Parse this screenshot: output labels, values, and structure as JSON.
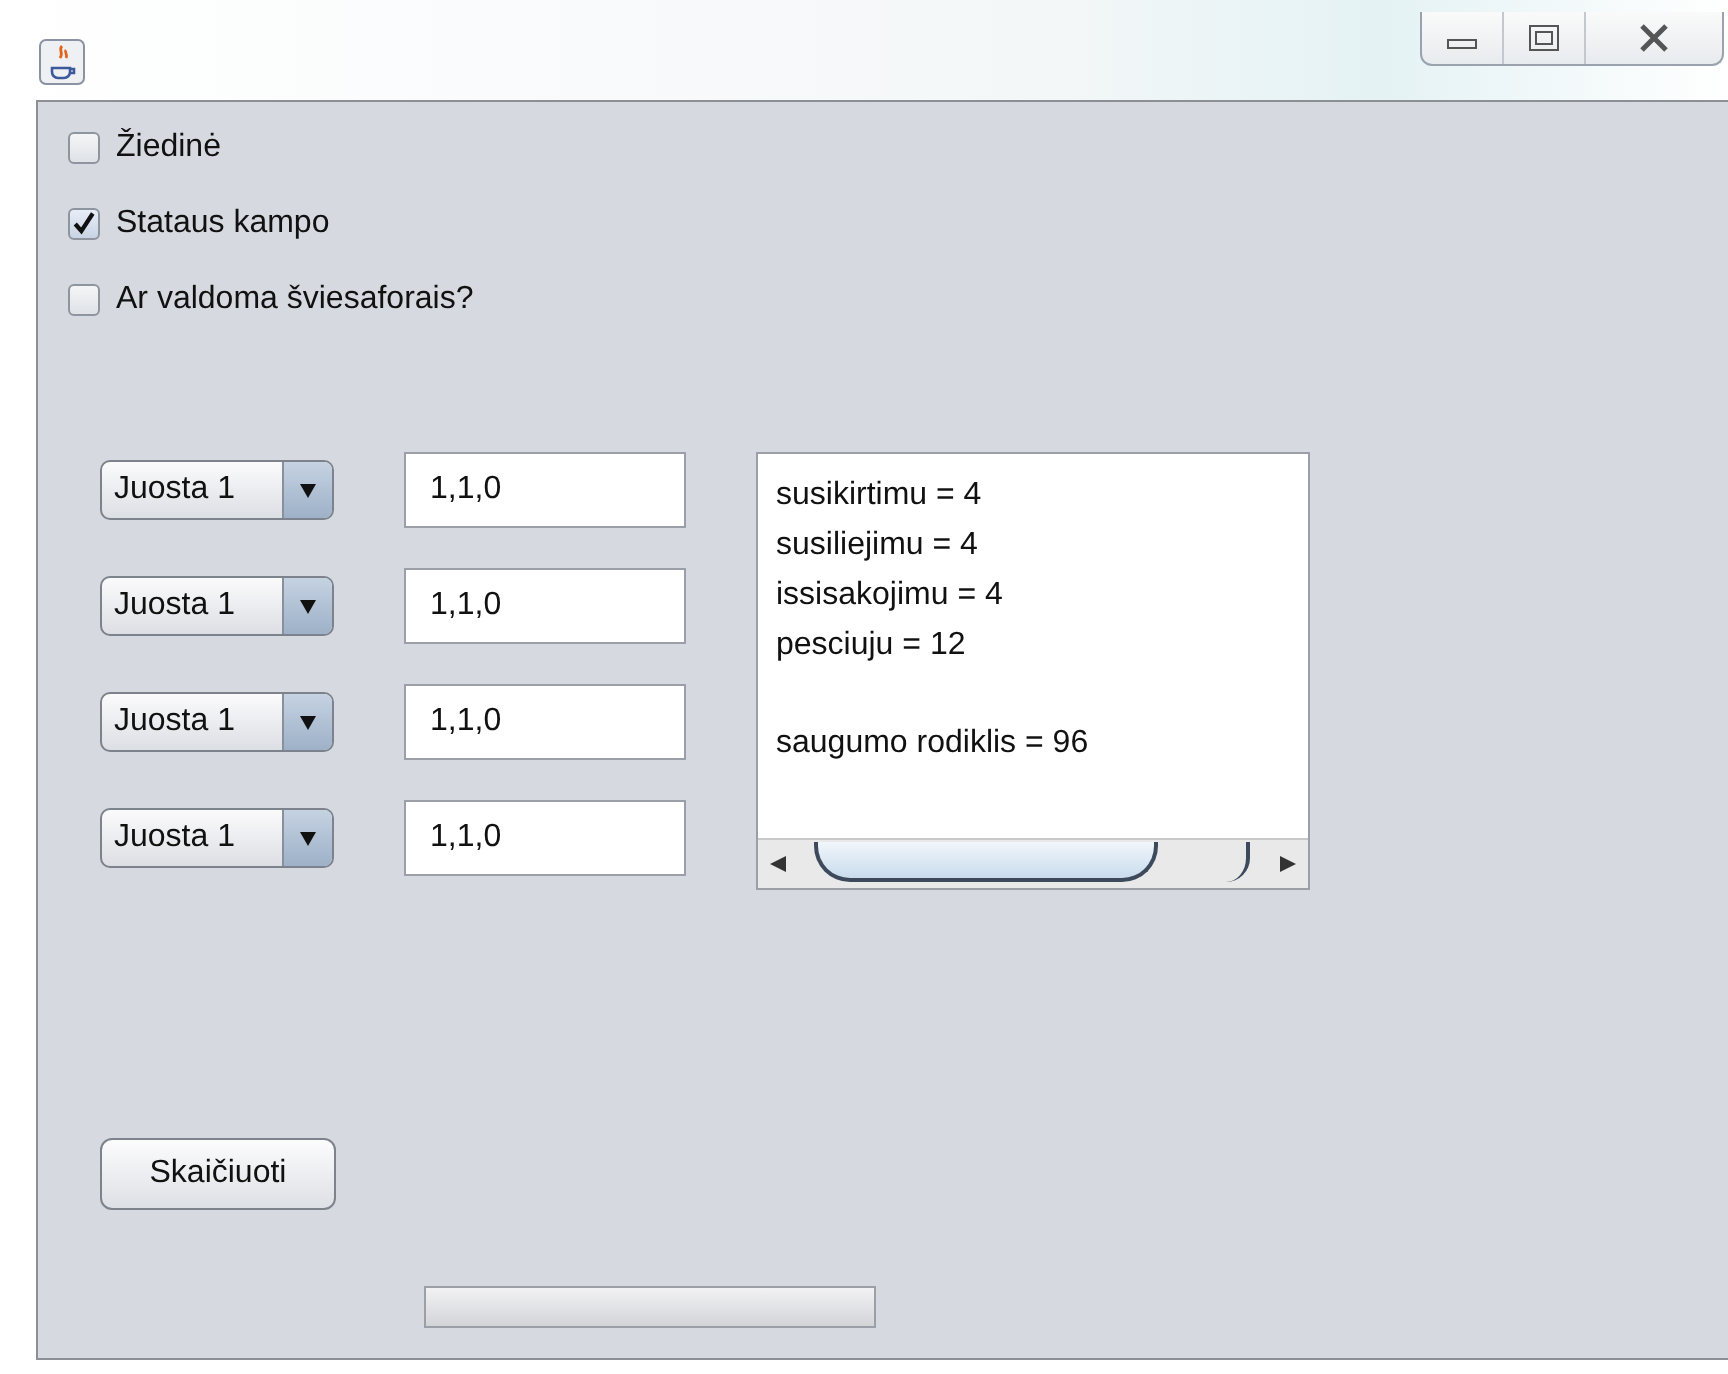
{
  "options": [
    {
      "label": "Žiedinė",
      "checked": false
    },
    {
      "label": "Stataus kampo",
      "checked": true
    },
    {
      "label": "Ar valdoma šviesaforais?",
      "checked": false
    }
  ],
  "lanes": [
    {
      "choice": "Juosta 1",
      "value": "1,1,0"
    },
    {
      "choice": "Juosta 1",
      "value": "1,1,0"
    },
    {
      "choice": "Juosta 1",
      "value": "1,1,0"
    },
    {
      "choice": "Juosta 1",
      "value": "1,1,0"
    }
  ],
  "results": {
    "paragraphs": [
      [
        "susikirtimu = 4",
        "susiliejimu = 4",
        "issisakojimu = 4",
        "pesciuju = 12"
      ],
      [
        "saugumo rodiklis = 96"
      ]
    ]
  },
  "calculate_button": "Skaičiuoti",
  "progress": {
    "level": 0
  }
}
